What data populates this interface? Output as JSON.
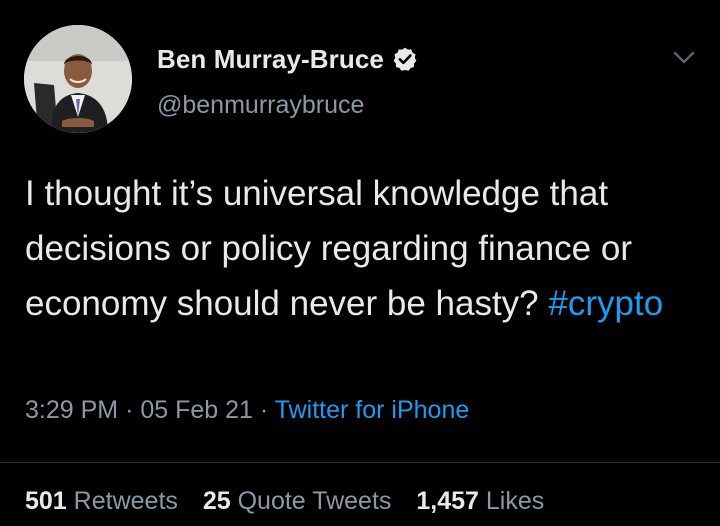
{
  "tweet": {
    "author": {
      "display_name": "Ben Murray-Bruce",
      "handle": "@benmurraybruce",
      "verified": true
    },
    "text": "I thought it’s universal knowledge that decisions or policy regarding finance or economy should never be hasty?",
    "hashtag": "#crypto",
    "time": "3:29 PM",
    "date": "05 Feb 21",
    "separator": "·",
    "source": "Twitter for iPhone",
    "stats": {
      "retweets_count": "501",
      "retweets_label": "Retweets",
      "quote_tweets_count": "25",
      "quote_tweets_label": "Quote Tweets",
      "likes_count": "1,457",
      "likes_label": "Likes"
    }
  },
  "icons": {
    "verified": "verified-badge-icon",
    "menu": "chevron-down-icon"
  },
  "colors": {
    "background": "#000000",
    "text_primary": "#e7e9ea",
    "text_secondary": "#8b98a5",
    "link": "#1d9bf0",
    "divider": "#2f3336"
  }
}
